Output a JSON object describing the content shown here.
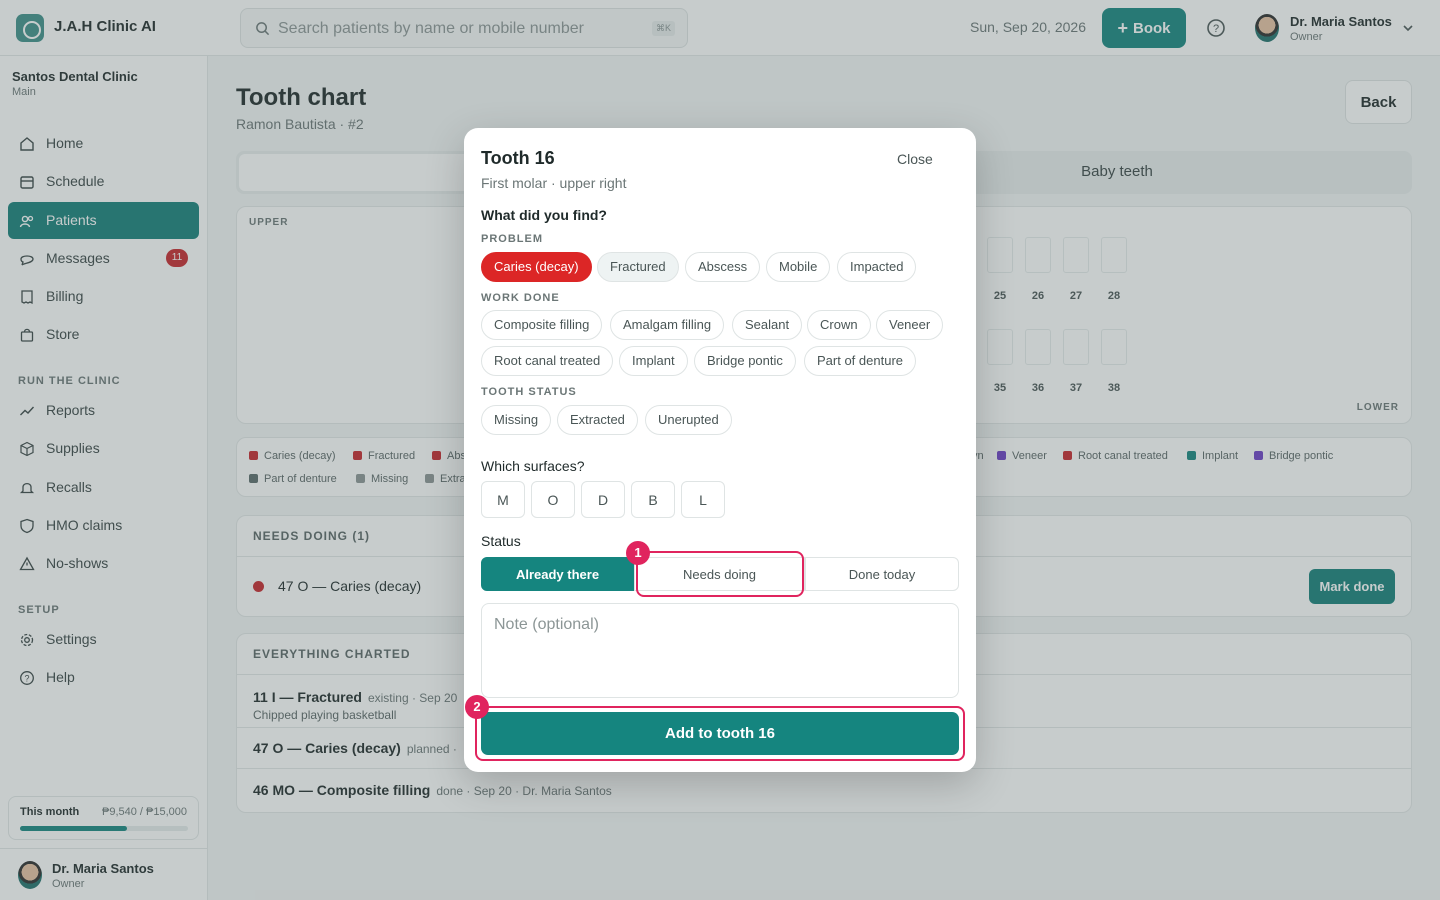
{
  "header": {
    "brand": "J.A.H Clinic AI",
    "search_placeholder": "Search patients by name or mobile number",
    "search_shortcut": "⌘K",
    "date": "Sun, Sep 20, 2026",
    "book_label": "Book",
    "user_name": "Dr. Maria Santos",
    "user_role": "Owner"
  },
  "sidebar": {
    "clinic_name": "Santos Dental Clinic",
    "clinic_branch": "Main",
    "items": [
      {
        "label": "Home",
        "icon": "home-icon"
      },
      {
        "label": "Schedule",
        "icon": "calendar-icon"
      },
      {
        "label": "Patients",
        "icon": "users-icon",
        "active": true
      },
      {
        "label": "Messages",
        "icon": "message-icon",
        "badge": "11"
      },
      {
        "label": "Billing",
        "icon": "receipt-icon"
      },
      {
        "label": "Store",
        "icon": "bag-icon"
      }
    ],
    "section_run": "RUN THE CLINIC",
    "run_items": [
      {
        "label": "Reports",
        "icon": "trend-icon"
      },
      {
        "label": "Supplies",
        "icon": "box-icon"
      },
      {
        "label": "Recalls",
        "icon": "bell-icon"
      },
      {
        "label": "HMO claims",
        "icon": "shield-icon"
      },
      {
        "label": "No-shows",
        "icon": "warning-icon"
      }
    ],
    "section_setup": "SETUP",
    "setup_items": [
      {
        "label": "Settings",
        "icon": "gear-icon"
      },
      {
        "label": "Help",
        "icon": "help-icon"
      }
    ],
    "month_label": "This month",
    "month_value": "₱9,540 / ₱15,000",
    "month_progress": 0.636,
    "footer_user_name": "Dr. Maria Santos",
    "footer_user_role": "Owner"
  },
  "main": {
    "title": "Tooth chart",
    "subtitle": "Ramon Bautista · #2",
    "back_label": "Back",
    "tab_baby": "Baby teeth",
    "upper_label": "UPPER",
    "lower_label": "LOWER",
    "upper_teeth": [
      "25",
      "26",
      "27",
      "28"
    ],
    "lower_teeth": [
      "35",
      "36",
      "37",
      "38"
    ],
    "legend": [
      {
        "label": "Caries (decay)",
        "color": "#c8262c"
      },
      {
        "label": "Fractured",
        "color": "#c8262c"
      },
      {
        "label": "Abs",
        "color": "#c8262c"
      },
      {
        "label": "vn",
        "color": "#5b6b6b"
      },
      {
        "label": "Veneer",
        "color": "#6d3fc8"
      },
      {
        "label": "Root canal treated",
        "color": "#c8262c"
      },
      {
        "label": "Implant",
        "color": "#15857f"
      },
      {
        "label": "Bridge pontic",
        "color": "#6d3fc8"
      },
      {
        "label": "Part of denture",
        "color": "#5b6b6b"
      },
      {
        "label": "Missing",
        "color": "#8c9696"
      },
      {
        "label": "Extra",
        "color": "#8c9696"
      }
    ],
    "needs_header": "NEEDS DOING (1)",
    "needs_item": "47 O — Caries (decay)",
    "mark_done": "Mark done",
    "charted_header": "EVERYTHING CHARTED",
    "charted": [
      {
        "title": "11 I — Fractured",
        "meta": "existing · Sep 20",
        "note": "Chipped playing basketball"
      },
      {
        "title": "47 O — Caries (decay)",
        "meta": "planned ·",
        "note": ""
      },
      {
        "title": "46 MO — Composite filling",
        "meta": "done · Sep 20 · Dr. Maria Santos",
        "note": ""
      }
    ]
  },
  "modal": {
    "title": "Tooth 16",
    "subtitle": "First molar · upper right",
    "close_label": "Close",
    "question_find": "What did you find?",
    "problem_label": "PROBLEM",
    "problems": [
      "Caries (decay)",
      "Fractured",
      "Abscess",
      "Mobile",
      "Impacted"
    ],
    "work_label": "WORK DONE",
    "work": [
      "Composite filling",
      "Amalgam filling",
      "Sealant",
      "Crown",
      "Veneer",
      "Root canal treated",
      "Implant",
      "Bridge pontic",
      "Part of denture"
    ],
    "status_label_caps": "TOOTH STATUS",
    "tooth_status": [
      "Missing",
      "Extracted",
      "Unerupted"
    ],
    "question_surfaces": "Which surfaces?",
    "surfaces": [
      "M",
      "O",
      "D",
      "B",
      "L"
    ],
    "status_label": "Status",
    "status_options": [
      "Already there",
      "Needs doing",
      "Done today"
    ],
    "note_placeholder": "Note (optional)",
    "add_label": "Add to tooth 16",
    "marker_1": "1",
    "marker_2": "2"
  }
}
